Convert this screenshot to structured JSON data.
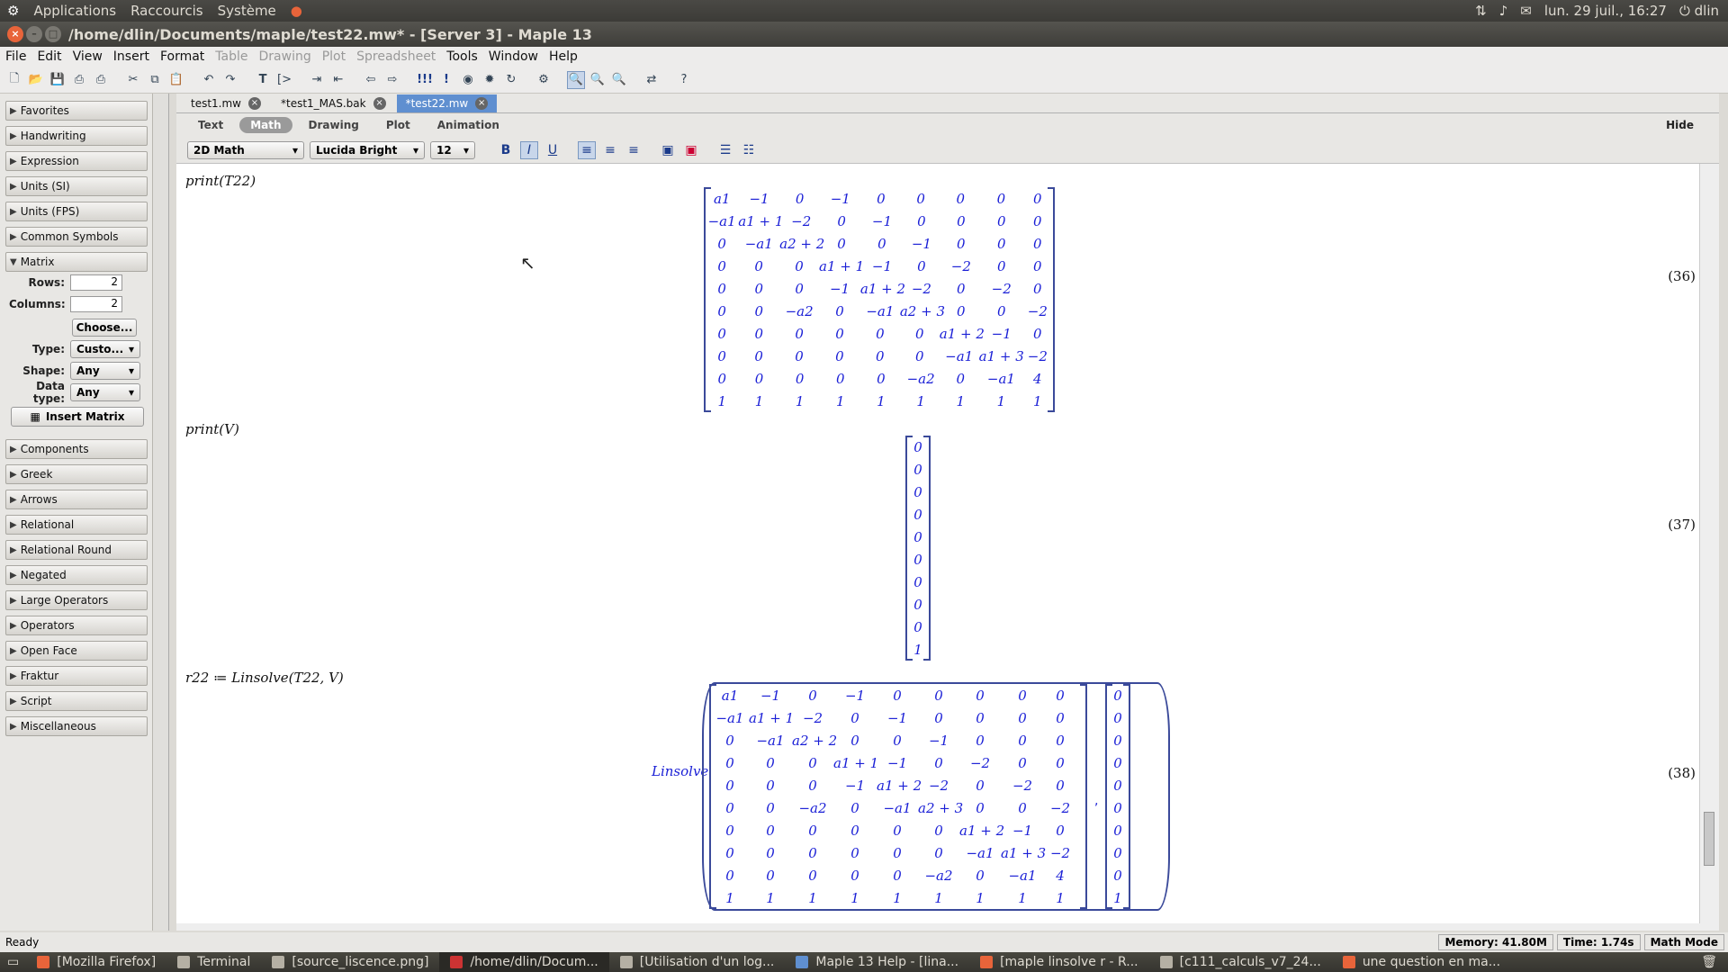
{
  "topbar": {
    "menus": [
      "Applications",
      "Raccourcis",
      "Système"
    ],
    "clock": "lun. 29 juil., 16:27",
    "user": "dlin"
  },
  "window": {
    "title": "/home/dlin/Documents/maple/test22.mw* - [Server 3] - Maple 13"
  },
  "menubar": [
    {
      "label": "File",
      "enabled": true
    },
    {
      "label": "Edit",
      "enabled": true
    },
    {
      "label": "View",
      "enabled": true
    },
    {
      "label": "Insert",
      "enabled": true
    },
    {
      "label": "Format",
      "enabled": true
    },
    {
      "label": "Table",
      "enabled": false
    },
    {
      "label": "Drawing",
      "enabled": false
    },
    {
      "label": "Plot",
      "enabled": false
    },
    {
      "label": "Spreadsheet",
      "enabled": false
    },
    {
      "label": "Tools",
      "enabled": true
    },
    {
      "label": "Window",
      "enabled": true
    },
    {
      "label": "Help",
      "enabled": true
    }
  ],
  "palettes": {
    "top": [
      "Favorites",
      "Handwriting",
      "Expression",
      "Units (SI)",
      "Units (FPS)",
      "Common Symbols"
    ],
    "matrix": {
      "header": "Matrix",
      "rows_label": "Rows:",
      "rows_value": "2",
      "cols_label": "Columns:",
      "cols_value": "2",
      "choose": "Choose...",
      "type_label": "Type:",
      "type_value": "Custo...",
      "shape_label": "Shape:",
      "shape_value": "Any",
      "dtype_label": "Data type:",
      "dtype_value": "Any",
      "insert": "Insert Matrix"
    },
    "bottom": [
      "Components",
      "Greek",
      "Arrows",
      "Relational",
      "Relational Round",
      "Negated",
      "Large Operators",
      "Operators",
      "Open Face",
      "Fraktur",
      "Script",
      "Miscellaneous"
    ]
  },
  "tabs": [
    {
      "label": "test1.mw",
      "active": false
    },
    {
      "label": "*test1_MAS.bak",
      "active": false
    },
    {
      "label": "*test22.mw",
      "active": true
    }
  ],
  "context_tabs": [
    "Text",
    "Math",
    "Drawing",
    "Plot",
    "Animation"
  ],
  "context_active": "Math",
  "hide_label": "Hide",
  "format": {
    "mode": "2D Math",
    "font": "Lucida Bright",
    "size": "12"
  },
  "document": {
    "input1": "print(T22)",
    "input2": "print(V)",
    "input3": "r22 ≔ Linsolve(T22, V)",
    "eq1": "(36)",
    "eq2": "(37)",
    "eq3": "(38)",
    "linsolve_label": "Linsolve",
    "T22": [
      [
        "a1",
        "-1",
        "0",
        "-1",
        "0",
        "0",
        "0",
        "0",
        "0"
      ],
      [
        "-a1",
        "a1 + 1",
        "-2",
        "0",
        "-1",
        "0",
        "0",
        "0",
        "0"
      ],
      [
        "0",
        "-a1",
        "a2 + 2",
        "0",
        "0",
        "-1",
        "0",
        "0",
        "0"
      ],
      [
        "0",
        "0",
        "0",
        "a1 + 1",
        "-1",
        "0",
        "-2",
        "0",
        "0"
      ],
      [
        "0",
        "0",
        "0",
        "-1",
        "a1 + 2",
        "-2",
        "0",
        "-2",
        "0"
      ],
      [
        "0",
        "0",
        "-a2",
        "0",
        "-a1",
        "a2 + 3",
        "0",
        "0",
        "-2"
      ],
      [
        "0",
        "0",
        "0",
        "0",
        "0",
        "0",
        "a1 + 2",
        "-1",
        "0"
      ],
      [
        "0",
        "0",
        "0",
        "0",
        "0",
        "0",
        "-a1",
        "a1 + 3",
        "-2"
      ],
      [
        "0",
        "0",
        "0",
        "0",
        "0",
        "-a2",
        "0",
        "-a1",
        "4"
      ],
      [
        "1",
        "1",
        "1",
        "1",
        "1",
        "1",
        "1",
        "1",
        "1"
      ]
    ],
    "V": [
      "0",
      "0",
      "0",
      "0",
      "0",
      "0",
      "0",
      "0",
      "0",
      "1"
    ]
  },
  "status": {
    "left": "Ready",
    "memory": "Memory: 41.80M",
    "time": "Time: 1.74s",
    "mode": "Math Mode"
  },
  "taskbar": [
    {
      "label": "[Mozilla Firefox]",
      "active": false
    },
    {
      "label": "Terminal",
      "active": false
    },
    {
      "label": "[source_liscence.png]",
      "active": false
    },
    {
      "label": "/home/dlin/Docum...",
      "active": true
    },
    {
      "label": "[Utilisation d'un log...",
      "active": false
    },
    {
      "label": "Maple 13 Help - [lina...",
      "active": false
    },
    {
      "label": "[maple linsolve r - R...",
      "active": false
    },
    {
      "label": "[c111_calculs_v7_24...",
      "active": false
    },
    {
      "label": "une question en ma...",
      "active": false
    }
  ]
}
